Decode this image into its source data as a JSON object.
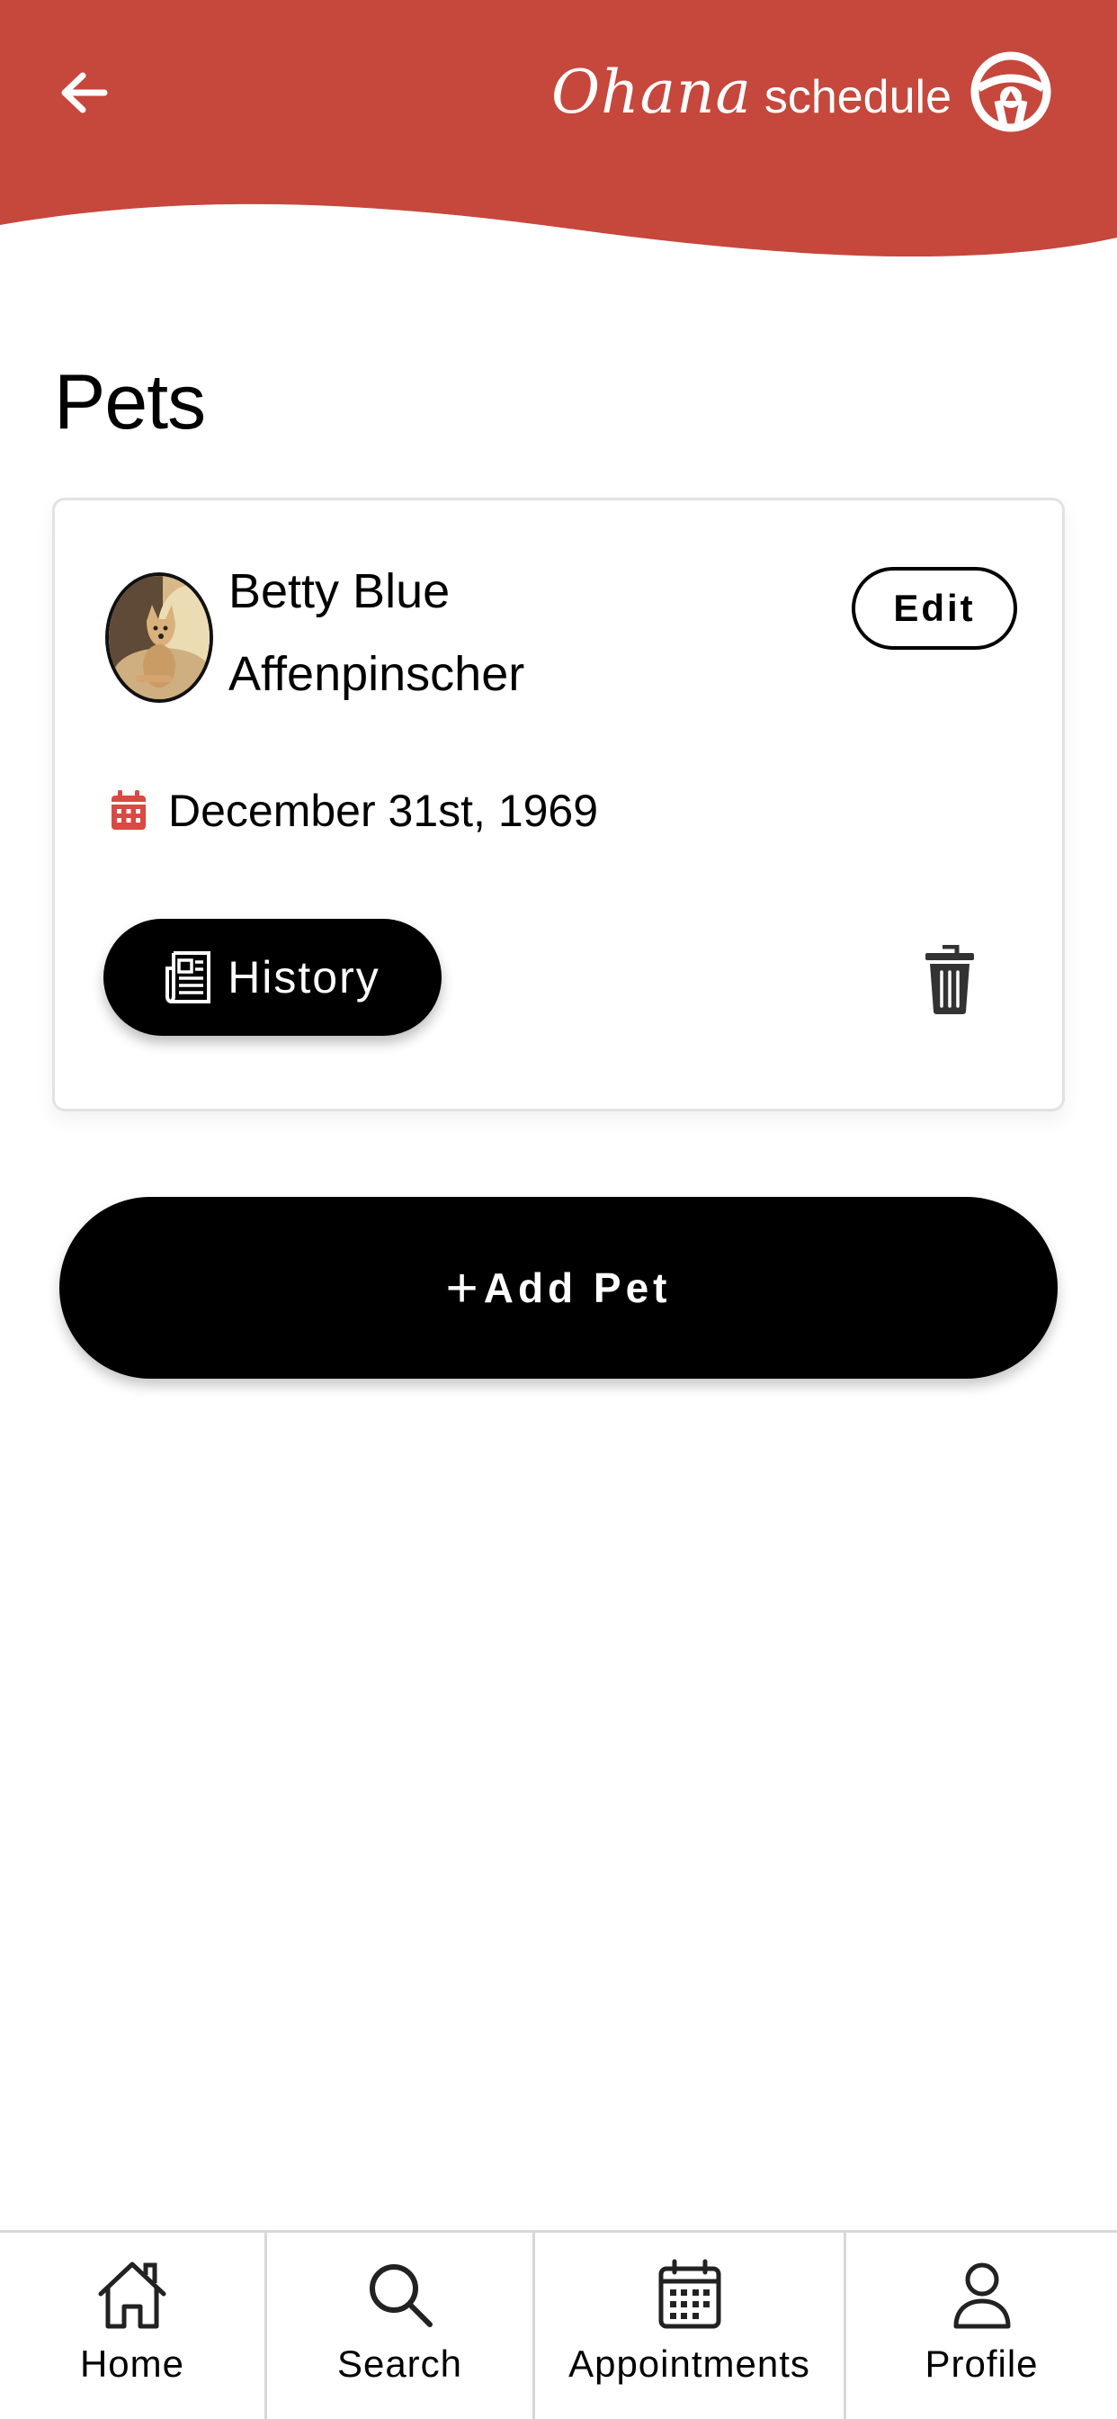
{
  "header": {
    "brand_script": "Ohana",
    "brand_word": "schedule",
    "back_icon": "arrow-left-icon",
    "logo_icon": "steering-wheel-icon",
    "color": "#c6473c"
  },
  "page": {
    "title": "Pets"
  },
  "pets": [
    {
      "name": "Betty Blue",
      "breed": "Affenpinscher",
      "birth_date": "December 31st, 1969",
      "edit_label": "Edit",
      "history_label": "History",
      "calendar_icon": "calendar-icon",
      "history_icon": "newspaper-icon",
      "delete_icon": "trash-icon"
    }
  ],
  "actions": {
    "add_pet_plus": "+",
    "add_pet_label": "Add Pet"
  },
  "bottom_nav": [
    {
      "label": "Home",
      "icon": "home-icon"
    },
    {
      "label": "Search",
      "icon": "search-icon"
    },
    {
      "label": "Appointments",
      "icon": "calendar-grid-icon"
    },
    {
      "label": "Profile",
      "icon": "user-icon"
    }
  ],
  "colors": {
    "accent": "#c6473c",
    "calendar_icon": "#d84a43",
    "button_bg": "#000000",
    "divider": "#d8d8d8"
  }
}
